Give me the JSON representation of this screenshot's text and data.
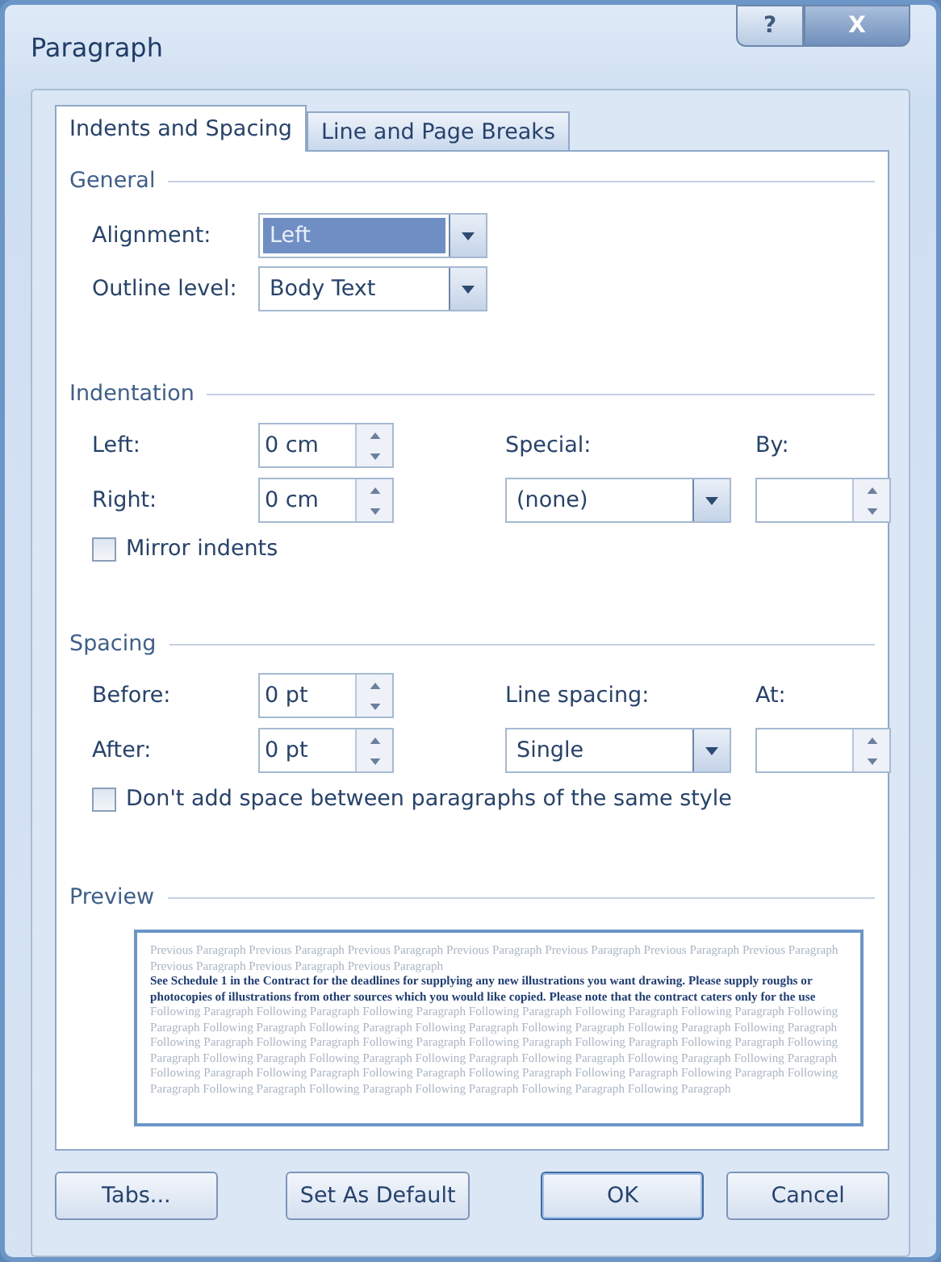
{
  "window": {
    "title": "Paragraph",
    "controls": [
      {
        "kind": "help",
        "label": "?"
      },
      {
        "kind": "close",
        "label": "X"
      }
    ]
  },
  "tabs": [
    {
      "label": "Indents and Spacing",
      "selected": true
    },
    {
      "label": "Line and Page Breaks",
      "selected": false
    }
  ],
  "general": {
    "title": "General",
    "fields": [
      {
        "label": "Alignment:",
        "value": "Left",
        "focused": true
      },
      {
        "label": "Outline level:",
        "value": "Body Text",
        "focused": false
      }
    ]
  },
  "indentation": {
    "title": "Indentation",
    "left": {
      "label": "Left:",
      "value": "0 cm"
    },
    "right": {
      "label": "Right:",
      "value": "0 cm"
    },
    "special": {
      "label": "Special:",
      "value": "(none)"
    },
    "by": {
      "label": "By:"
    },
    "checkbox": {
      "label": "Mirror indents",
      "checked": false
    }
  },
  "spacing": {
    "title": "Spacing",
    "left": {
      "label": "Before:",
      "value": "0 pt"
    },
    "right": {
      "label": "After:",
      "value": "0 pt"
    },
    "special": {
      "label": "Line spacing:",
      "value": "Single"
    },
    "by": {
      "label": "At:"
    },
    "checkbox": {
      "label": "Don't add space between paragraphs of the same style",
      "checked": false
    }
  },
  "preview": {
    "title": "Preview",
    "previous": "Previous Paragraph Previous Paragraph Previous Paragraph Previous Paragraph Previous Paragraph Previous Paragraph Previous Paragraph Previous Paragraph Previous Paragraph Previous Paragraph",
    "current": "See Schedule 1 in the Contract for the deadlines for supplying any new illustrations you want drawing. Please supply roughs or photocopies of illustrations from other sources which you would like copied.  Please note that the contract caters only for the use",
    "following": "Following Paragraph Following Paragraph Following Paragraph Following Paragraph Following Paragraph Following Paragraph Following Paragraph Following Paragraph Following Paragraph Following Paragraph Following Paragraph Following Paragraph Following Paragraph Following Paragraph Following Paragraph Following Paragraph Following Paragraph Following Paragraph Following Paragraph Following Paragraph Following Paragraph Following Paragraph Following Paragraph Following Paragraph Following Paragraph Following Paragraph Following Paragraph Following Paragraph Following Paragraph Following Paragraph Following Paragraph Following Paragraph Following Paragraph Following Paragraph Following Paragraph Following Paragraph Following Paragraph Following Paragraph"
  },
  "buttons": [
    {
      "label": "Tabs...",
      "default": false
    },
    {
      "label": "Set As Default",
      "default": false
    },
    {
      "label": "OK",
      "default": true
    },
    {
      "label": "Cancel",
      "default": false
    }
  ]
}
